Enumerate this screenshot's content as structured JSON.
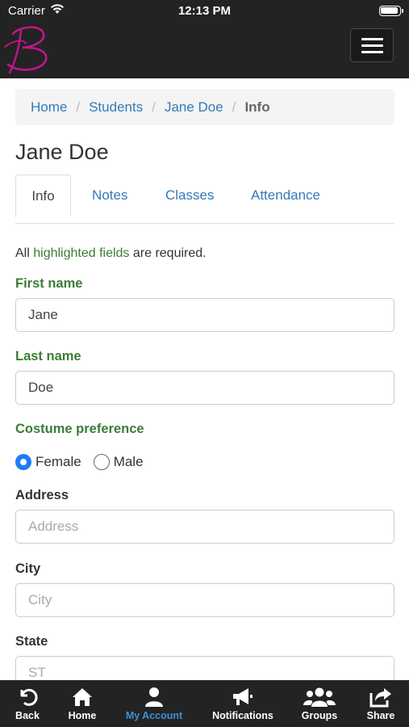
{
  "status_bar": {
    "carrier": "Carrier",
    "time": "12:13 PM"
  },
  "breadcrumb": {
    "home": "Home",
    "students": "Students",
    "student": "Jane Doe",
    "current": "Info"
  },
  "page_title": "Jane Doe",
  "tabs": [
    "Info",
    "Notes",
    "Classes",
    "Attendance"
  ],
  "required_note": {
    "prefix": "All ",
    "highlight": "highlighted fields",
    "suffix": " are required."
  },
  "form": {
    "first_name": {
      "label": "First name",
      "value": "Jane"
    },
    "last_name": {
      "label": "Last name",
      "value": "Doe"
    },
    "costume": {
      "label": "Costume preference",
      "options": [
        "Female",
        "Male"
      ],
      "selected": "Female"
    },
    "address": {
      "label": "Address",
      "placeholder": "Address"
    },
    "city": {
      "label": "City",
      "placeholder": "City"
    },
    "state": {
      "label": "State",
      "placeholder": "ST"
    }
  },
  "bottom_nav": [
    {
      "label": "Back",
      "icon": "back-arrow-icon"
    },
    {
      "label": "Home",
      "icon": "home-icon"
    },
    {
      "label": "My Account",
      "icon": "user-icon",
      "active": true
    },
    {
      "label": "Notifications",
      "icon": "megaphone-icon"
    },
    {
      "label": "Groups",
      "icon": "group-icon"
    },
    {
      "label": "Share",
      "icon": "share-icon"
    }
  ],
  "colors": {
    "bar": "#232323",
    "link": "#337ab7",
    "required": "#3c7d35",
    "active_nav": "#3f8fd6",
    "logo": "#c0168c"
  }
}
